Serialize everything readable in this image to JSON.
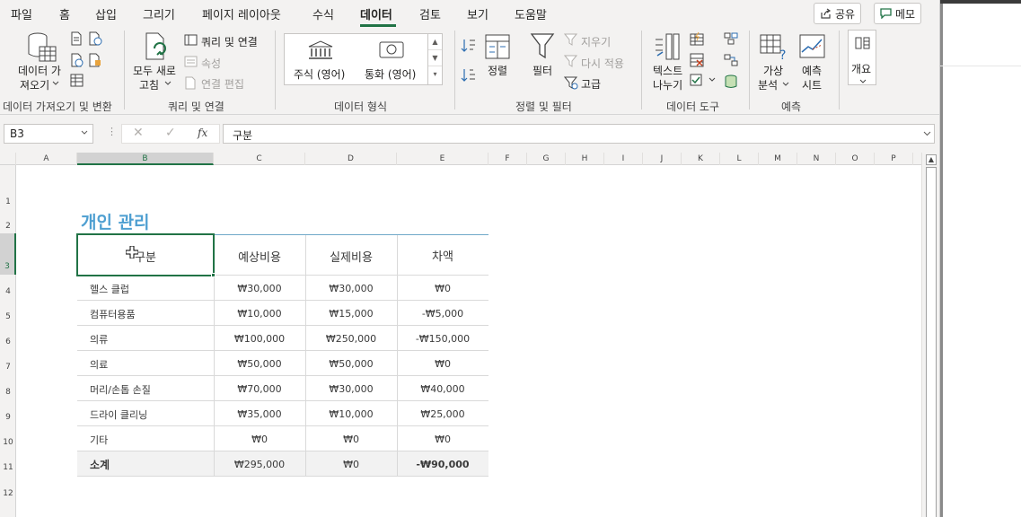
{
  "tabs": [
    "파일",
    "홈",
    "삽입",
    "그리기",
    "페이지 레이아웃",
    "수식",
    "데이터",
    "검토",
    "보기",
    "도움말"
  ],
  "active_tab": "데이터",
  "top_buttons": {
    "share": "공유",
    "memo": "메모"
  },
  "ribbon": {
    "get_data": {
      "line1": "데이터 가",
      "line2": "져오기"
    },
    "refresh": {
      "line1": "모두 새로",
      "line2": "고침"
    },
    "queries": "쿼리 및 연결",
    "properties": "속성",
    "edit_links": "연결 편집",
    "stocks": "주식 (영어)",
    "currency": "통화 (영어)",
    "sort": "정렬",
    "filter": "필터",
    "clear": "지우기",
    "reapply": "다시 적용",
    "advanced": "고급",
    "text_to_columns": {
      "line1": "텍스트",
      "line2": "나누기"
    },
    "whatif": {
      "line1": "가상",
      "line2": "분석"
    },
    "forecast": {
      "line1": "예측",
      "line2": "시트"
    },
    "outline": "개요",
    "groups": {
      "get_transform": "데이터 가져오기 및 변환",
      "queries_connections": "쿼리 및 연결",
      "data_types": "데이터 형식",
      "sort_filter": "정렬 및 필터",
      "data_tools": "데이터 도구",
      "forecast": "예측"
    }
  },
  "formula_bar": {
    "name_box": "B3",
    "fx": "fx",
    "value": "구분"
  },
  "columns": [
    "A",
    "B",
    "C",
    "D",
    "E",
    "F",
    "G",
    "H",
    "I",
    "J",
    "K",
    "L",
    "M",
    "N",
    "O",
    "P"
  ],
  "rows": [
    "1",
    "2",
    "3",
    "4",
    "5",
    "6",
    "7",
    "8",
    "9",
    "10",
    "11",
    "12"
  ],
  "sheet": {
    "title": "개인 관리",
    "headers": [
      "구분",
      "예상비용",
      "실제비용",
      "차액"
    ],
    "data": [
      [
        "헬스 클럽",
        "₩30,000",
        "₩30,000",
        "₩0"
      ],
      [
        "컴퓨터용품",
        "₩10,000",
        "₩15,000",
        "-₩5,000"
      ],
      [
        "의류",
        "₩100,000",
        "₩250,000",
        "-₩150,000"
      ],
      [
        "의료",
        "₩50,000",
        "₩50,000",
        "₩0"
      ],
      [
        "머리/손톱 손질",
        "₩70,000",
        "₩30,000",
        "₩40,000"
      ],
      [
        "드라이 클리닝",
        "₩35,000",
        "₩10,000",
        "₩25,000"
      ],
      [
        "기타",
        "₩0",
        "₩0",
        "₩0"
      ]
    ],
    "total": [
      "소계",
      "₩295,000",
      "₩0",
      "-₩90,000"
    ]
  },
  "colors": {
    "accent": "#217346",
    "title": "#4e9fd1"
  }
}
